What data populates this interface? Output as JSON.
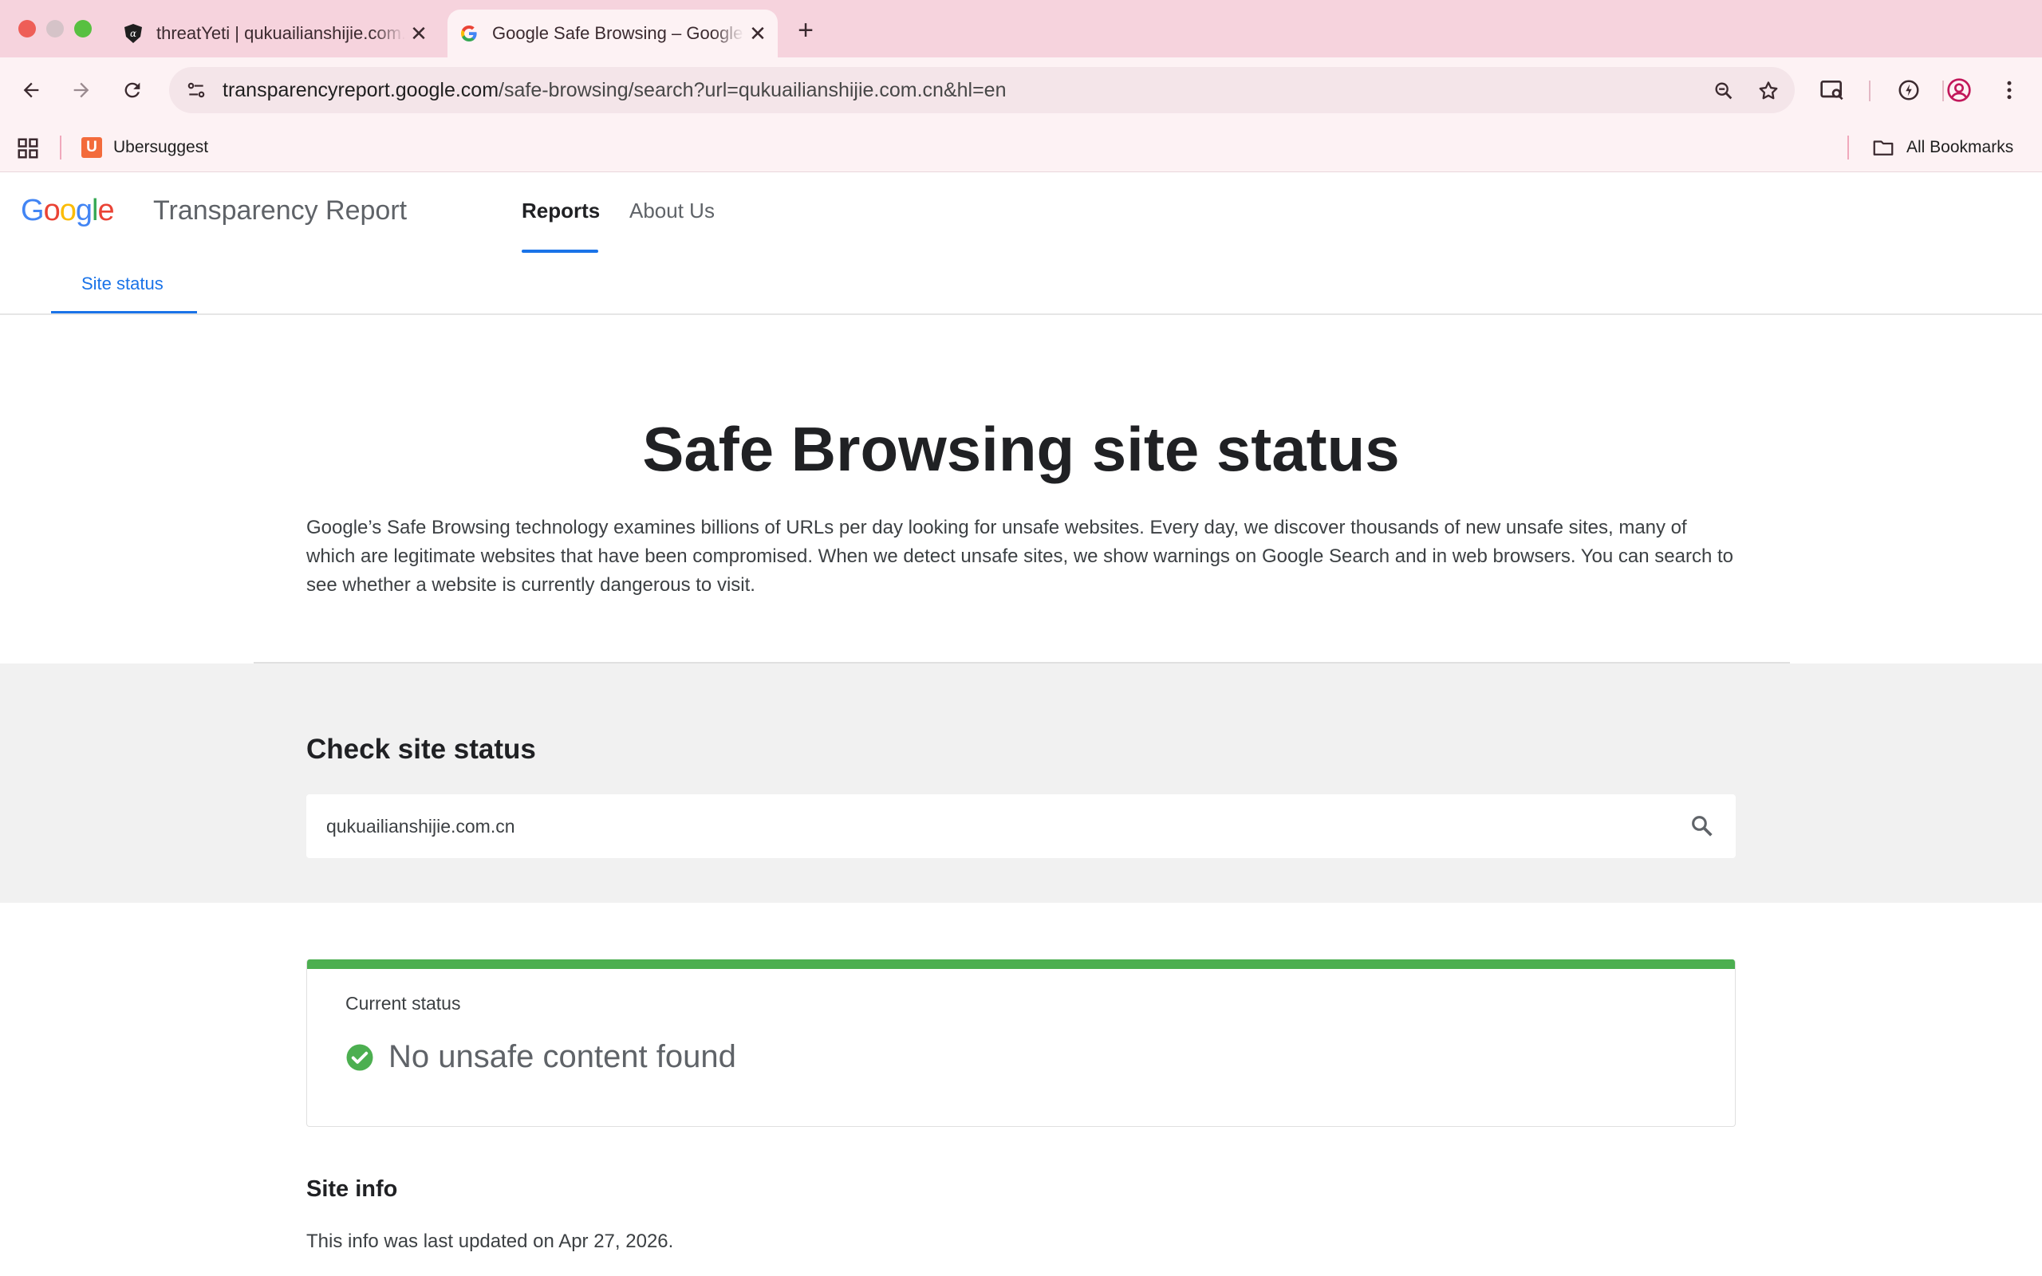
{
  "browser": {
    "tabs": [
      {
        "title": "threatYeti | qukuailianshijie.com.cn",
        "active": false
      },
      {
        "title": "Google Safe Browsing – Google Transparency Report",
        "active": true
      }
    ],
    "url_domain": "transparencyreport.google.com",
    "url_path": "/safe-browsing/search?url=qukuailianshijie.com.cn&hl=en",
    "bookmarks": [
      {
        "label": "Ubersuggest"
      }
    ],
    "all_bookmarks_label": "All Bookmarks"
  },
  "site": {
    "logo_letters": [
      "G",
      "o",
      "o",
      "g",
      "l",
      "e"
    ],
    "product_title": "Transparency Report",
    "nav": [
      {
        "label": "Reports",
        "active": true
      },
      {
        "label": "About Us",
        "active": false
      }
    ],
    "subnav": {
      "label": "Site status"
    }
  },
  "hero": {
    "title": "Safe Browsing site status",
    "description": "Google’s Safe Browsing technology examines billions of URLs per day looking for unsafe websites. Every day, we discover thousands of new unsafe sites, many of which are legitimate websites that have been compromised. When we detect unsafe sites, we show warnings on Google Search and in web browsers. You can search to see whether a website is currently dangerous to visit."
  },
  "check": {
    "title": "Check site status",
    "search_value": "qukuailianshijie.com.cn"
  },
  "status": {
    "label": "Current status",
    "result": "No unsafe content found",
    "color": "#4caf50"
  },
  "site_info": {
    "title": "Site info",
    "updated": "This info was last updated on Apr 27, 2026."
  },
  "colors": {
    "tab_strip": "#f6d3dd",
    "toolbar": "#fdf2f4",
    "accent": "#1a73e8"
  }
}
